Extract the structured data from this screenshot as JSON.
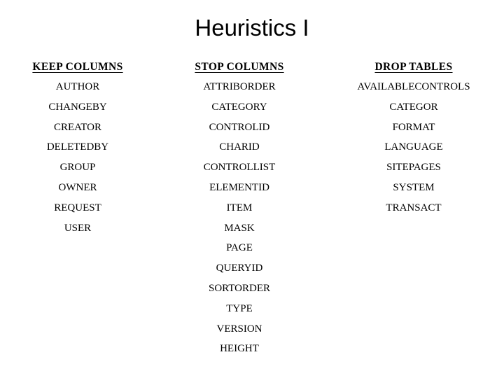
{
  "slide": {
    "title": "Heuristics I",
    "background_color": "#ffffff",
    "text_color": "#000000"
  },
  "table": {
    "columns": [
      {
        "header": "KEEP COLUMNS",
        "items": [
          "AUTHOR",
          "CHANGEBY",
          "CREATOR",
          "DELETEDBY",
          "GROUP",
          "OWNER",
          "REQUEST",
          "USER"
        ]
      },
      {
        "header": "STOP COLUMNS",
        "items": [
          "ATTRIBORDER",
          "CATEGORY",
          "CONTROLID",
          "CHARID",
          "CONTROLLIST",
          "ELEMENTID",
          "ITEM",
          "MASK",
          "PAGE",
          "QUERYID",
          "SORTORDER",
          "TYPE",
          "VERSION",
          "HEIGHT"
        ]
      },
      {
        "header": "DROP TABLES",
        "items": [
          "AVAILABLECONTROLS",
          "CATEGOR",
          "FORMAT",
          "LANGUAGE",
          "SITEPAGES",
          "SYSTEM",
          "TRANSACT"
        ]
      }
    ]
  }
}
